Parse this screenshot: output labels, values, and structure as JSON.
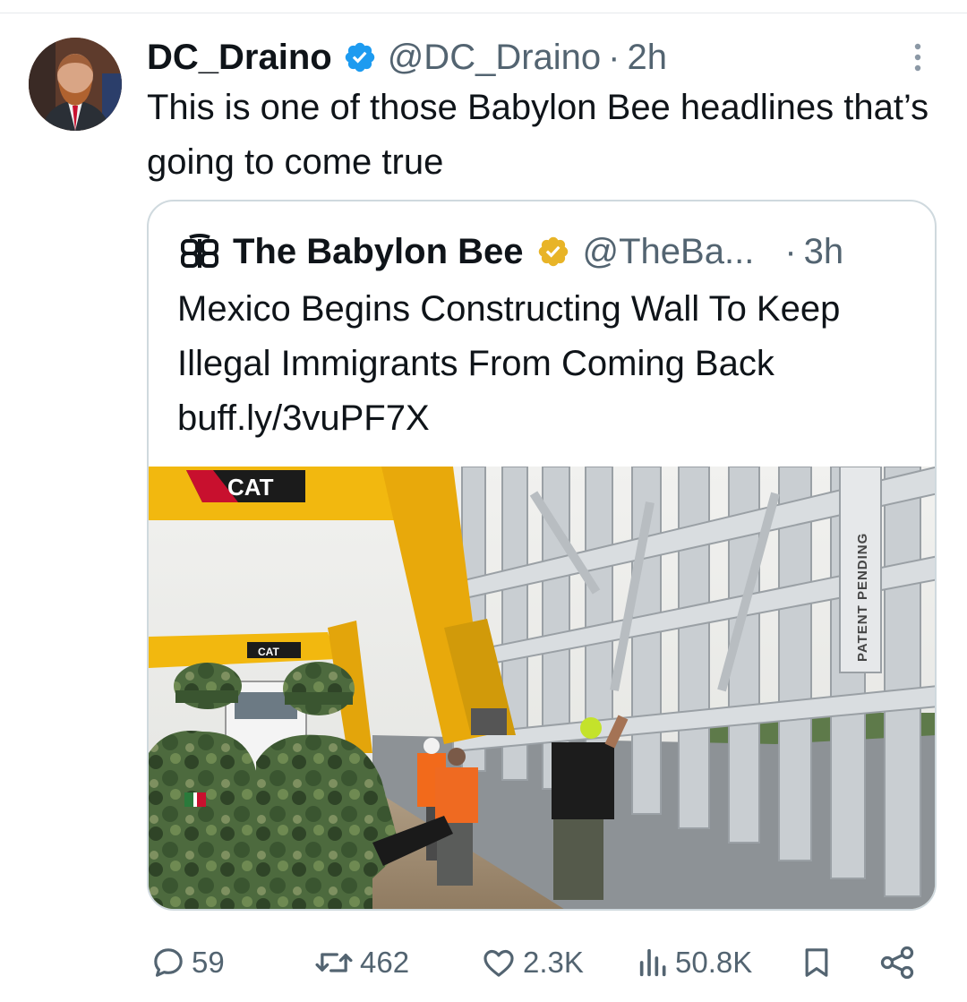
{
  "tweet": {
    "author_name": "DC_Draino",
    "handle": "@DC_Draino",
    "separator": "·",
    "time": "2h",
    "text": "This is one of those Babylon Bee headlines that’s going to come true",
    "verified_badge_color": "#1d9bf0"
  },
  "quoted_tweet": {
    "author_name": "The Babylon Bee",
    "handle": "@TheBa...",
    "separator": "·",
    "time": "3h",
    "text": "Mexico Begins Constructing Wall To Keep Illegal Immigrants From Coming Back buff.ly/3vuPF7X",
    "verified_badge_color": "#e8b427",
    "image": {
      "excavator_brand": "CAT",
      "excavator_brand_2": "CAT",
      "wall_sign": "PATENT PENDING"
    }
  },
  "actions": {
    "replies": "59",
    "retweets": "462",
    "likes": "2.3K",
    "views": "50.8K"
  },
  "icons": {
    "more": "more-vertical-icon",
    "reply": "reply-icon",
    "retweet": "retweet-icon",
    "like": "heart-icon",
    "views": "views-icon",
    "bookmark": "bookmark-icon",
    "share": "share-icon"
  }
}
